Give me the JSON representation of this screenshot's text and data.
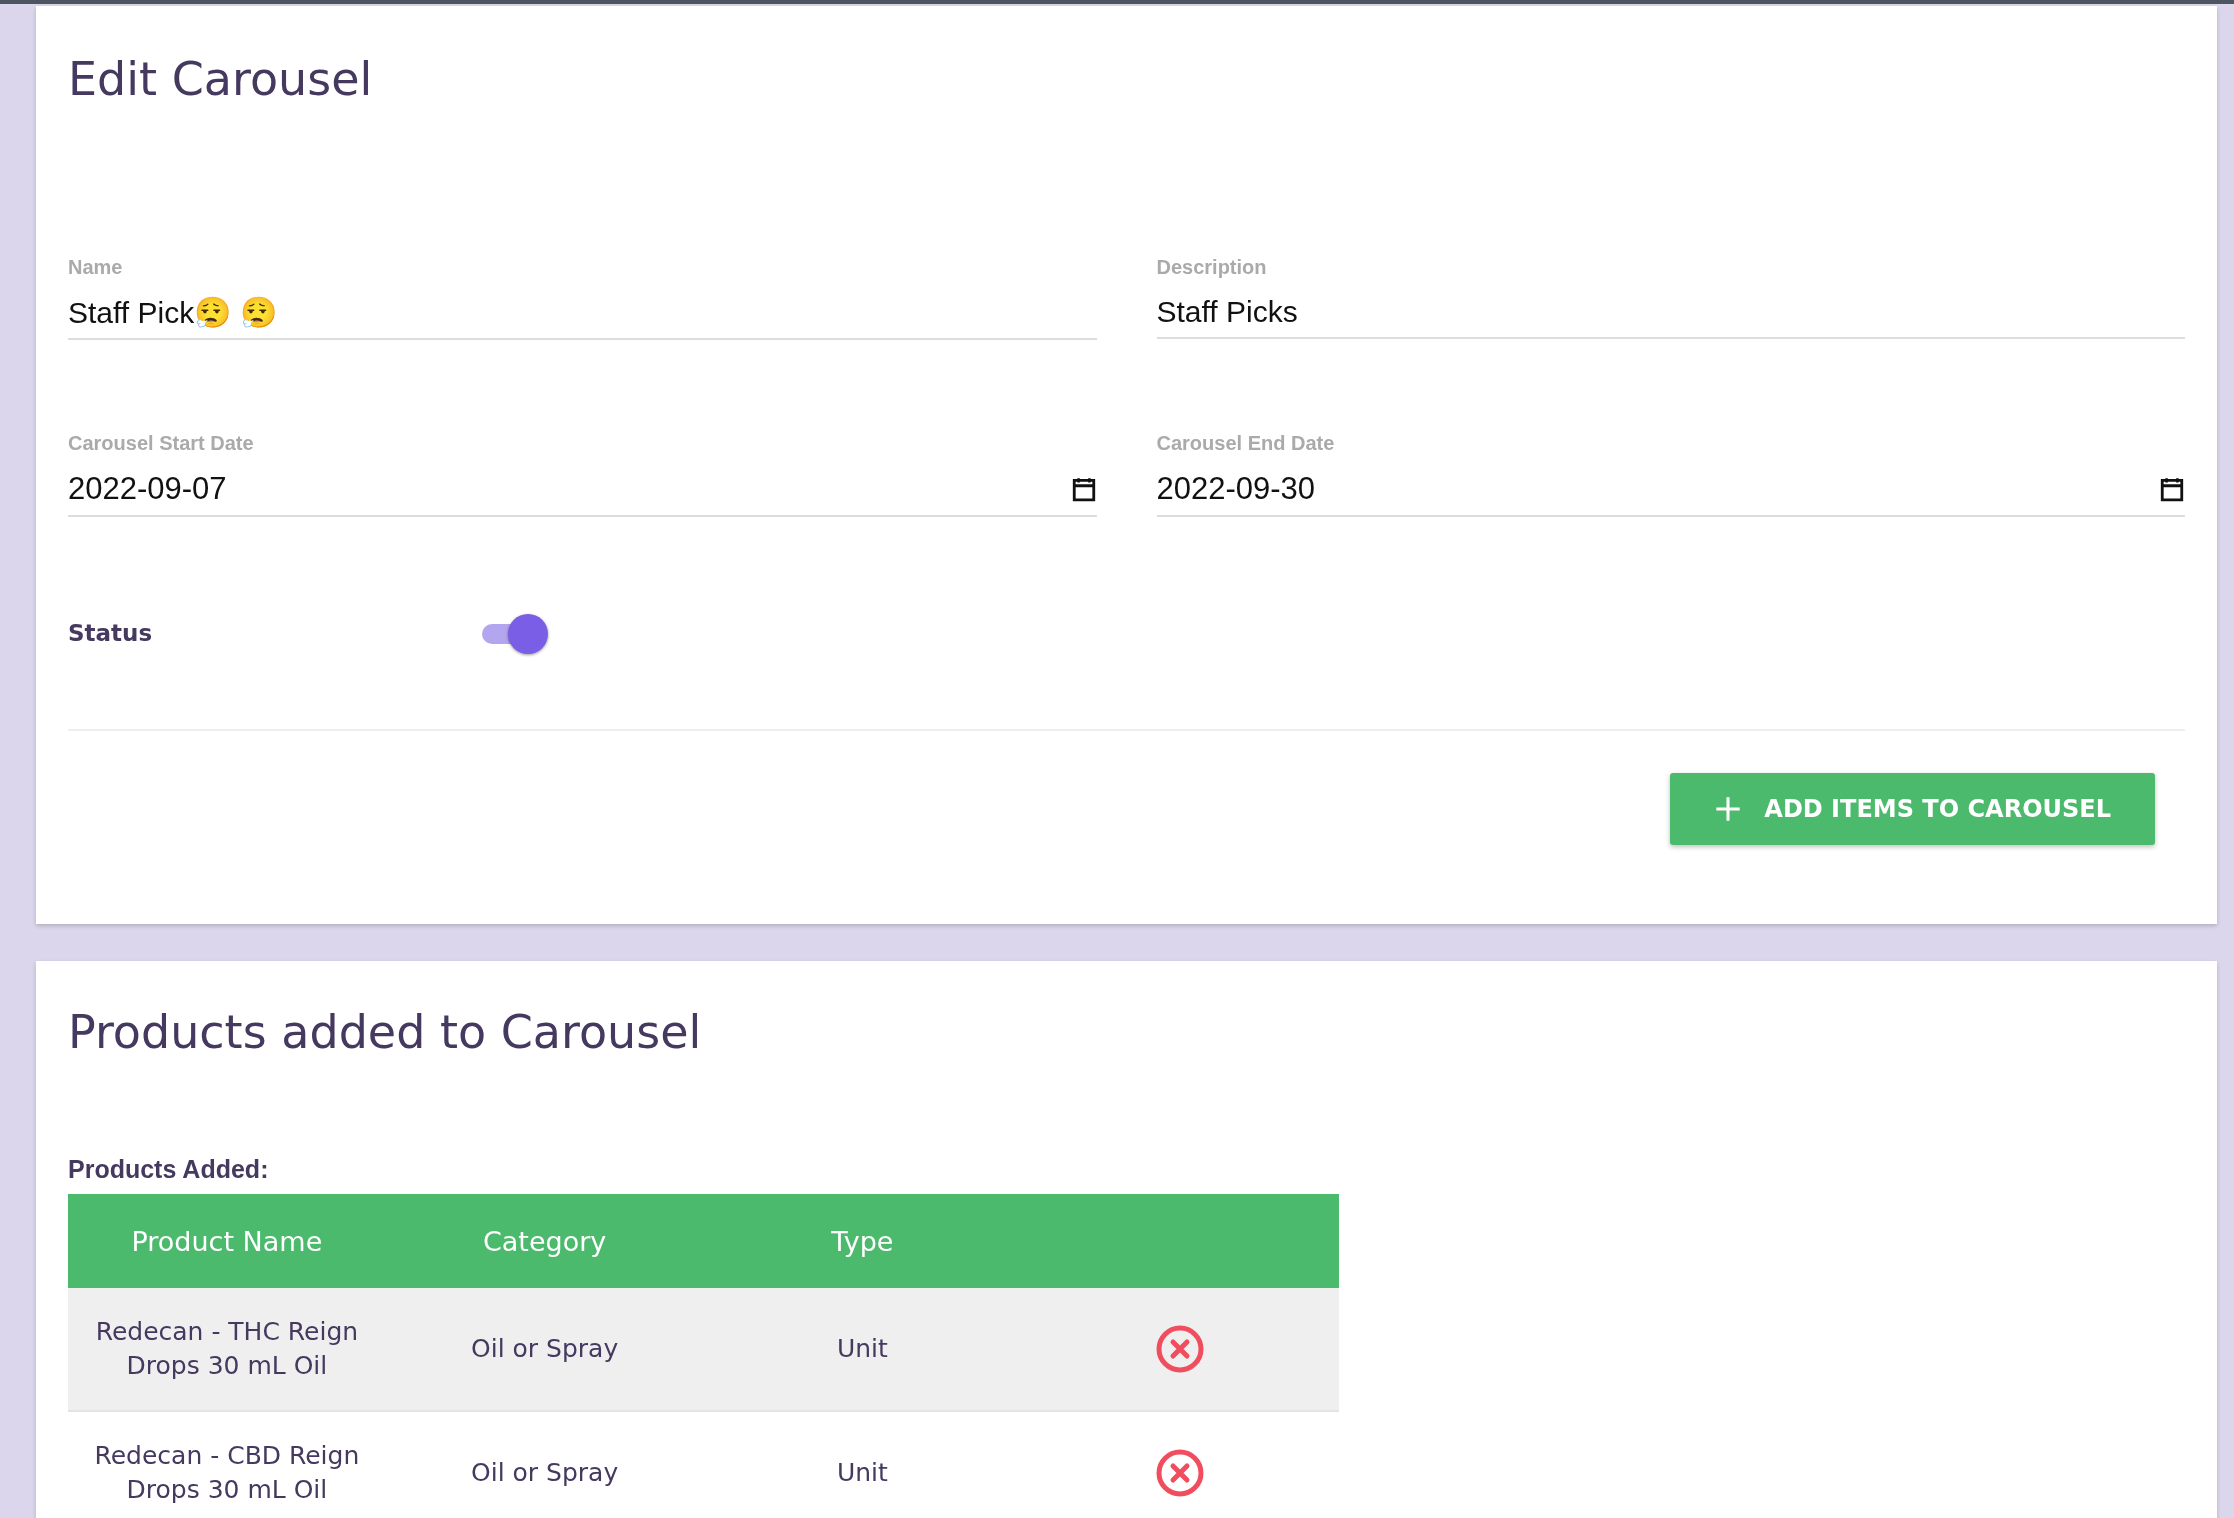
{
  "edit_card": {
    "title": "Edit Carousel",
    "fields": [
      {
        "kind": "text",
        "label": "Name",
        "value": "Staff Pick😮‍💨 😮‍💨"
      },
      {
        "kind": "text",
        "label": "Description",
        "value": "Staff Picks"
      },
      {
        "kind": "date",
        "label": "Carousel Start Date",
        "value": "2022-09-07"
      },
      {
        "kind": "date",
        "label": "Carousel End Date",
        "value": "2022-09-30"
      }
    ],
    "status": {
      "label": "Status",
      "on": true
    },
    "add_button": {
      "label": "ADD ITEMS TO CAROUSEL"
    }
  },
  "products_card": {
    "title": "Products added to Carousel",
    "table_title": "Products Added:",
    "table": {
      "columns": [
        "Product Name",
        "Category",
        "Type"
      ],
      "rows": [
        {
          "product_name": "Redecan - THC Reign Drops 30 mL Oil",
          "category": "Oil or Spray",
          "type": "Unit"
        },
        {
          "product_name": "Redecan - CBD Reign Drops 30 mL Oil",
          "category": "Oil or Spray",
          "type": "Unit"
        }
      ]
    }
  }
}
